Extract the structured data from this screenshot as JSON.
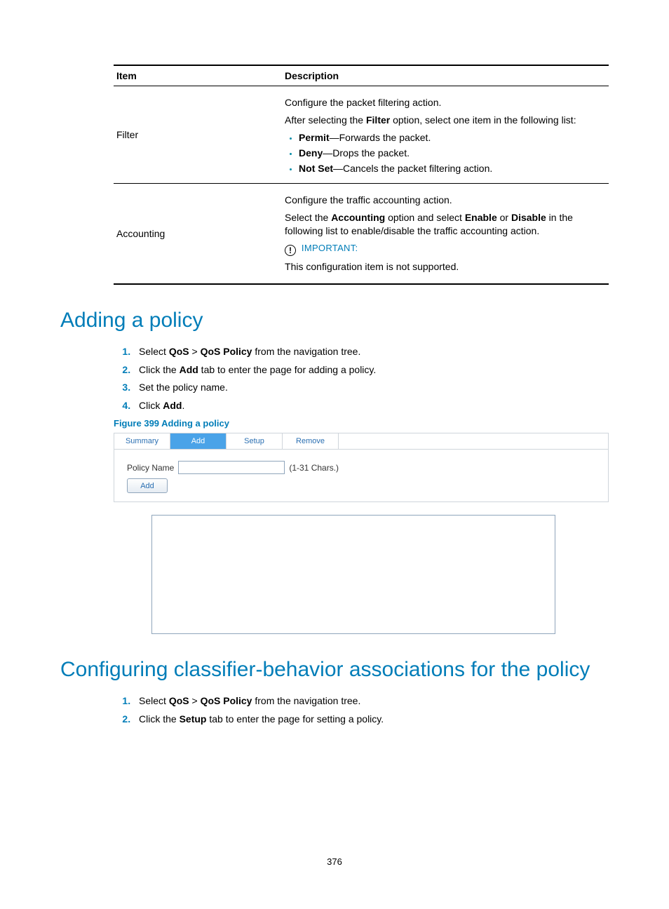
{
  "table": {
    "header_item": "Item",
    "header_desc": "Description",
    "rows": [
      {
        "item": "Filter",
        "p1": "Configure the packet filtering action.",
        "p2_pre": "After selecting the ",
        "p2_bold": "Filter",
        "p2_post": " option, select one item in the following list:",
        "bullets": [
          {
            "b": "Permit",
            "t": "—Forwards the packet."
          },
          {
            "b": "Deny",
            "t": "—Drops the packet."
          },
          {
            "b": "Not Set",
            "t": "—Cancels the packet filtering action."
          }
        ]
      },
      {
        "item": "Accounting",
        "p1": "Configure the traffic accounting action.",
        "p2_pre": "Select the ",
        "p2_b1": "Accounting",
        "p2_mid": " option and select ",
        "p2_b2": "Enable",
        "p2_mid2": " or ",
        "p2_b3": "Disable",
        "p2_post": " in the following list to enable/disable the traffic accounting action.",
        "important_label": "IMPORTANT:",
        "important_body": "This configuration item is not supported."
      }
    ]
  },
  "section1": {
    "title": "Adding a policy",
    "steps": {
      "s1_pre": "Select ",
      "s1_b1": "QoS",
      "s1_mid": " > ",
      "s1_b2": "QoS Policy",
      "s1_post": " from the navigation tree.",
      "s2_pre": "Click the ",
      "s2_b1": "Add",
      "s2_post": " tab to enter the page for adding a policy.",
      "s3": "Set the policy name.",
      "s4_pre": "Click ",
      "s4_b1": "Add",
      "s4_post": "."
    },
    "figure_caption": "Figure 399 Adding a policy",
    "tabs": [
      "Summary",
      "Add",
      "Setup",
      "Remove"
    ],
    "active_tab_index": 1,
    "form": {
      "policy_name_label": "Policy Name",
      "policy_name_hint": "(1-31 Chars.)",
      "add_button": "Add"
    }
  },
  "section2": {
    "title": "Configuring classifier-behavior associations for the policy",
    "steps": {
      "s1_pre": "Select ",
      "s1_b1": "QoS",
      "s1_mid": " > ",
      "s1_b2": "QoS Policy",
      "s1_post": " from the navigation tree.",
      "s2_pre": "Click the ",
      "s2_b1": "Setup",
      "s2_post": " tab to enter the page for setting a policy."
    }
  },
  "page_number": "376"
}
